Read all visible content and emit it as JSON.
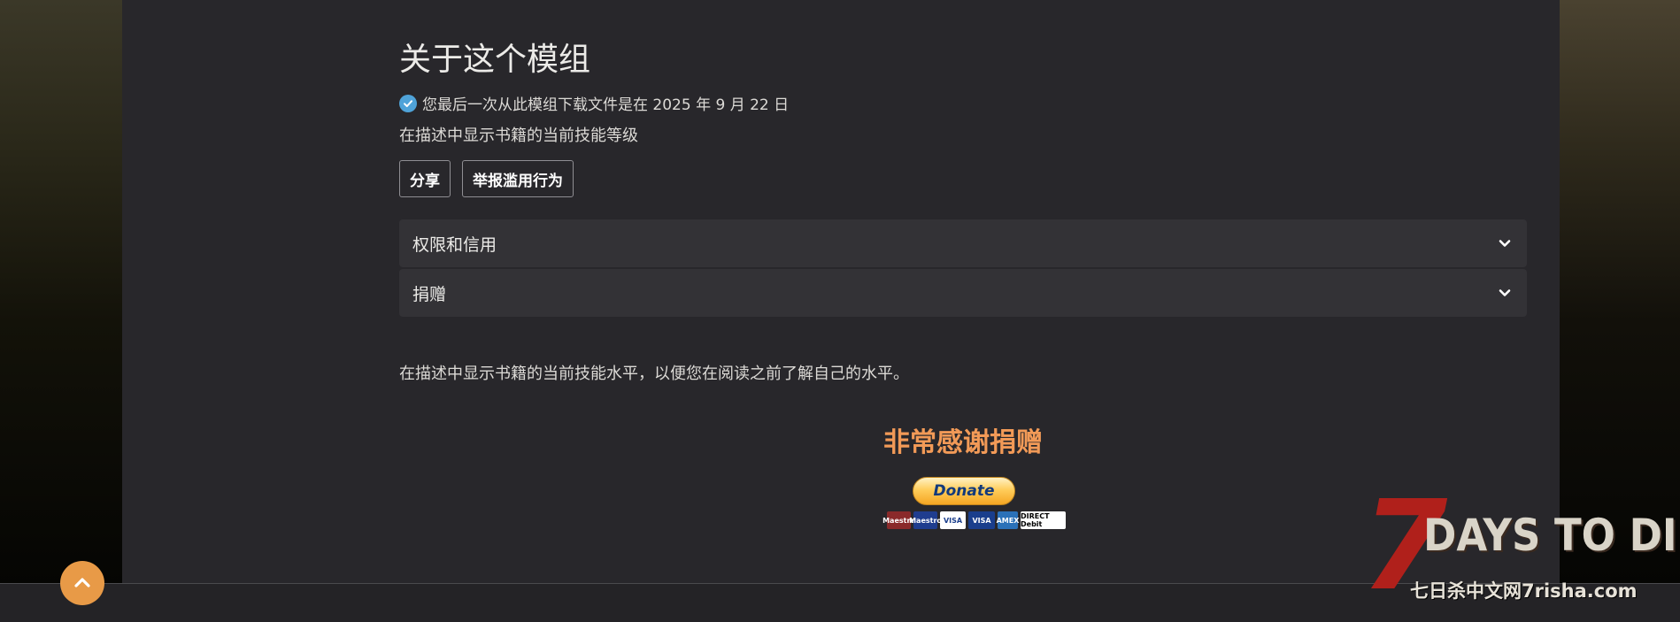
{
  "about": {
    "title": "关于这个模组",
    "download_notice": "您最后一次从此模组下载文件是在 2025 年 9 月 22 日",
    "summary": "在描述中显示书籍的当前技能等级"
  },
  "actions": {
    "share_label": "分享",
    "report_label": "举报滥用行为"
  },
  "accordions": [
    {
      "label": "权限和信用"
    },
    {
      "label": "捐赠"
    }
  ],
  "description": "在描述中显示书籍的当前技能水平，以便您在阅读之前了解自己的水平。",
  "donation": {
    "thanks": "非常感谢捐赠",
    "button_label": "Donate",
    "cards": [
      "Maestro",
      "Maestro",
      "VISA",
      "VISA",
      "AMEX",
      "DIRECT Debit"
    ]
  },
  "watermark": {
    "logo_number": "7",
    "logo_text": "DAYS TO DIE",
    "site_text": "七日杀中文网7risha.com"
  },
  "icons": {
    "verified": "check-circle-icon",
    "accordion": "chevron-down-icon",
    "scroll_top": "chevron-up-icon"
  },
  "colors": {
    "accent_orange": "#e89a47",
    "thanks_orange": "#f29a57",
    "verified_blue": "#4fa3d9"
  }
}
